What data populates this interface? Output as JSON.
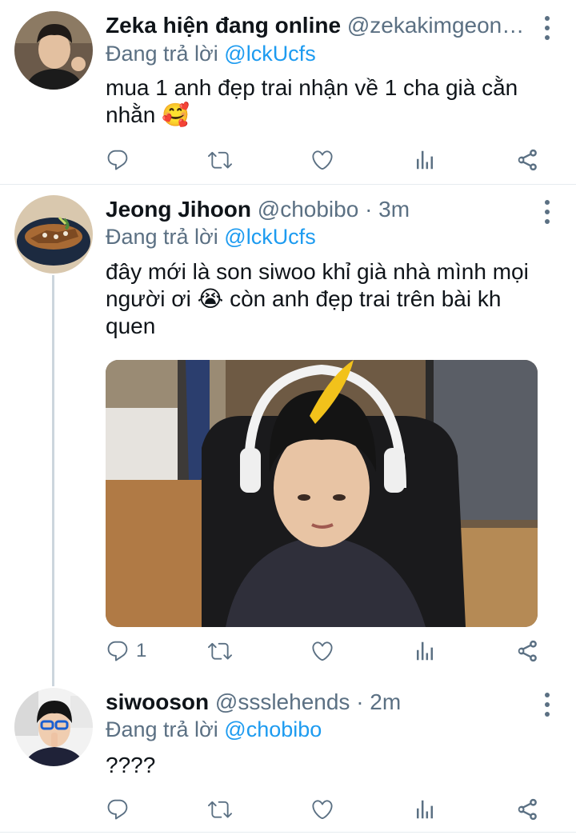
{
  "tweets": [
    {
      "name": "Zeka hiện đang online",
      "handle": "@zekakimgeon…",
      "time": "",
      "reply_prefix": "Đang trả lời",
      "reply_to": "@lckUcfs",
      "text": "mua 1 anh đẹp trai nhận về 1 cha già cằn nhằn 🥰",
      "reply_count": "",
      "avatar_icon": "avatar-photo"
    },
    {
      "name": "Jeong Jihoon",
      "handle": "@chobibo",
      "time": "· 3m",
      "reply_prefix": "Đang trả lời",
      "reply_to": "@lckUcfs",
      "text": "đây mới là son siwoo khỉ già nhà mình mọi người ơi 😭 còn anh đẹp trai trên bài kh quen",
      "reply_count": "1",
      "avatar_icon": "avatar-photo"
    },
    {
      "name": "siwooson",
      "handle": "@ssslehends",
      "time": "· 2m",
      "reply_prefix": "Đang trả lời",
      "reply_to": "@chobibo",
      "text": "????",
      "reply_count": "",
      "avatar_icon": "avatar-photo"
    }
  ],
  "icons": {
    "reply": "reply-icon",
    "retweet": "retweet-icon",
    "like": "like-icon",
    "analytics": "analytics-icon",
    "share": "share-icon",
    "more": "more-options-icon"
  },
  "colors": {
    "link": "#1d9bf0",
    "secondary": "#5b7083",
    "divider": "#e6ecf0",
    "thread_line": "#ccd6dd"
  }
}
